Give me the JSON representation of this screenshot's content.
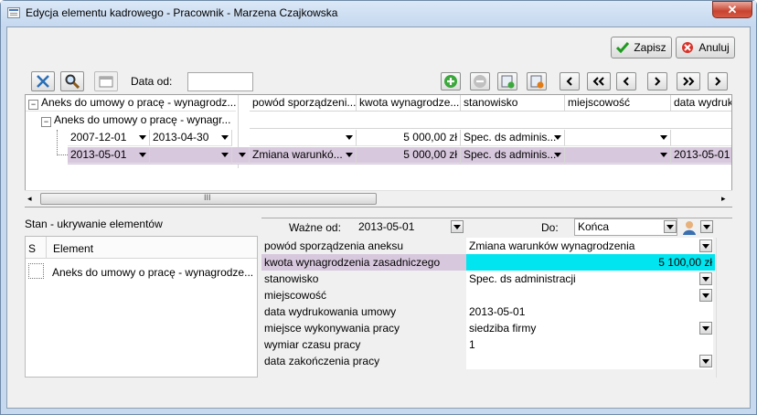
{
  "window": {
    "title": "Edycja elementu kadrowego - Pracownik - Marzena Czajkowska",
    "close_glyph": "✕"
  },
  "actions": {
    "save_label": "Zapisz",
    "cancel_label": "Anuluj"
  },
  "toolbar": {
    "date_from_label": "Data od:",
    "date_from_value": ""
  },
  "grid": {
    "tree_rows": [
      {
        "label": "Aneks do umowy o pracę - wynagrodz..."
      },
      {
        "label": "Aneks do umowy o pracę - wynagr..."
      }
    ],
    "columns": [
      "powód sporządzeni...",
      "kwota wynagrodze...",
      "stanowisko",
      "miejscowość",
      "data wydruk"
    ],
    "rows": [
      {
        "date_from": "2007-12-01",
        "date_to": "2013-04-30",
        "reason": "",
        "amount": "5 000,00 zł",
        "position": "Spec. ds adminis...",
        "place": "",
        "print_date": ""
      },
      {
        "date_from": "2013-05-01",
        "date_to": "",
        "reason": "Zmiana warunkó...",
        "amount": "5 000,00 zł",
        "position": "Spec. ds adminis...",
        "place": "",
        "print_date": "2013-05-01"
      }
    ],
    "scroll_grip": "III"
  },
  "state_panel": {
    "title": "Stan - ukrywanie elementów",
    "col_s": "S",
    "col_element": "Element",
    "items": [
      {
        "label": "Aneks do umowy o pracę - wynagrodze..."
      }
    ]
  },
  "form": {
    "valid_from_label": "Ważne od:",
    "valid_from_value": "2013-05-01",
    "to_label": "Do:",
    "to_value": "Końca",
    "fields": [
      {
        "label": "powód sporządzenia aneksu",
        "value": "Zmiana warunków wynagrodzenia"
      },
      {
        "label": "kwota wynagrodzenia zasadniczego",
        "value": "5 100,00 zł"
      },
      {
        "label": "stanowisko",
        "value": "Spec. ds administracji"
      },
      {
        "label": "miejscowość",
        "value": ""
      },
      {
        "label": "data wydrukowania umowy",
        "value": "2013-05-01"
      },
      {
        "label": "miejsce wykonywania pracy",
        "value": "siedziba firmy"
      },
      {
        "label": "wymiar czasu pracy",
        "value": "1"
      },
      {
        "label": "data zakończenia pracy",
        "value": ""
      }
    ]
  },
  "colors": {
    "selected_row": "#d8c8de",
    "highlight_field": "#00e5ef"
  }
}
